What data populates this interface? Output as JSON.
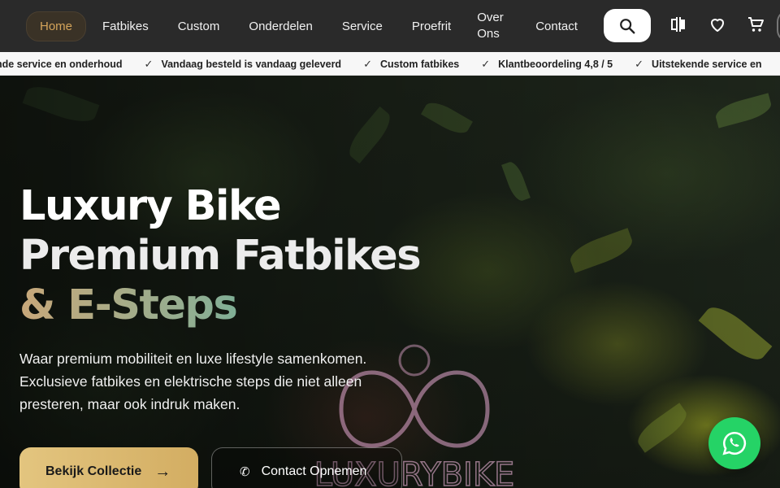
{
  "nav": {
    "items": [
      {
        "label": "Home",
        "active": true
      },
      {
        "label": "Fatbikes"
      },
      {
        "label": "Custom"
      },
      {
        "label": "Onderdelen"
      },
      {
        "label": "Service"
      },
      {
        "label": "Proefrit"
      },
      {
        "label": "Over Ons"
      },
      {
        "label": "Contact"
      }
    ],
    "icons": [
      "search-icon",
      "compare-icon",
      "heart-icon",
      "cart-icon"
    ]
  },
  "ticker": {
    "items": [
      "ende service en onderhoud",
      "Vandaag besteld is vandaag geleverd",
      "Custom fatbikes",
      "Klantbeoordeling 4,8 / 5",
      "Uitstekende service en"
    ]
  },
  "hero": {
    "title_line1": "Luxury Bike",
    "title_line2": "Premium Fatbikes",
    "title_line3": "& E-Steps",
    "subtitle": "Waar premium mobiliteit en luxe lifestyle samenkomen. Exclusieve fatbikes en elektrische steps die niet alleen presteren, maar ook indruk maken.",
    "primary_button": "Bekijk Collectie",
    "secondary_button": "Contact Opnemen",
    "neon_sign": "LUXURYBIKE"
  },
  "colors": {
    "nav_bg": "#2a2a2a",
    "accent_gold": "#d4a45a",
    "accent_teal": "#2fb3a6",
    "whatsapp": "#25d366"
  }
}
